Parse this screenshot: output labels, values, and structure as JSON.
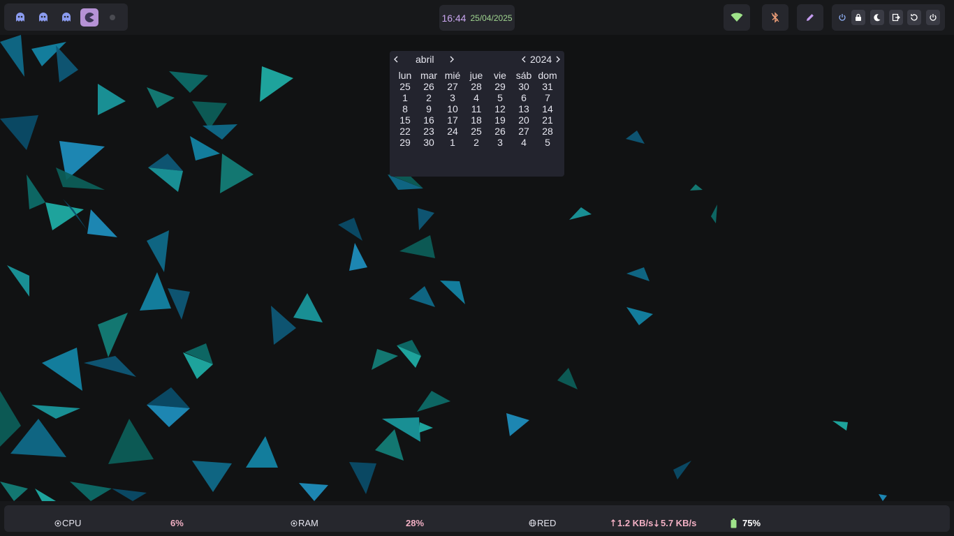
{
  "workspaces": [
    {
      "icon": "ghost-icon",
      "active": false
    },
    {
      "icon": "ghost-icon",
      "active": false
    },
    {
      "icon": "ghost-icon",
      "active": false
    },
    {
      "icon": "pacman-icon",
      "active": true
    },
    {
      "icon": "dot-icon",
      "active": false
    }
  ],
  "clock": {
    "time": "16:44",
    "date": "25/04/2025"
  },
  "tray": {
    "wifi_icon": "wifi-icon",
    "bluetooth_icon": "bluetooth-off-icon",
    "edit_icon": "pencil-icon"
  },
  "power_menu": [
    "power-icon",
    "lock-icon",
    "moon-icon",
    "logout-icon",
    "restart-icon",
    "shutdown-icon"
  ],
  "calendar": {
    "month": "abril",
    "year": "2024",
    "weekdays": [
      "lun",
      "mar",
      "mié",
      "jue",
      "vie",
      "sáb",
      "dom"
    ],
    "weeks": [
      [
        "25",
        "26",
        "27",
        "28",
        "29",
        "30",
        "31"
      ],
      [
        "1",
        "2",
        "3",
        "4",
        "5",
        "6",
        "7"
      ],
      [
        "8",
        "9",
        "10",
        "11",
        "12",
        "13",
        "14"
      ],
      [
        "15",
        "16",
        "17",
        "18",
        "19",
        "20",
        "21"
      ],
      [
        "22",
        "23",
        "24",
        "25",
        "26",
        "27",
        "28"
      ],
      [
        "29",
        "30",
        "1",
        "2",
        "3",
        "4",
        "5"
      ]
    ]
  },
  "stats": {
    "cpu_label": "CPU",
    "cpu_value": "6%",
    "ram_label": "RAM",
    "ram_value": "28%",
    "net_label": "RED",
    "net_up": "1.2 KB/s",
    "net_down": "5.7 KB/s",
    "battery_value": "75%"
  },
  "colors": {
    "accent": "#b692d6",
    "ghost": "#8b9cf0",
    "wifi": "#9fe38a",
    "bluetooth": "#f0a07a",
    "pencil": "#c59cf0",
    "power": "#8fb0f5",
    "value": "#f2b0c4"
  }
}
